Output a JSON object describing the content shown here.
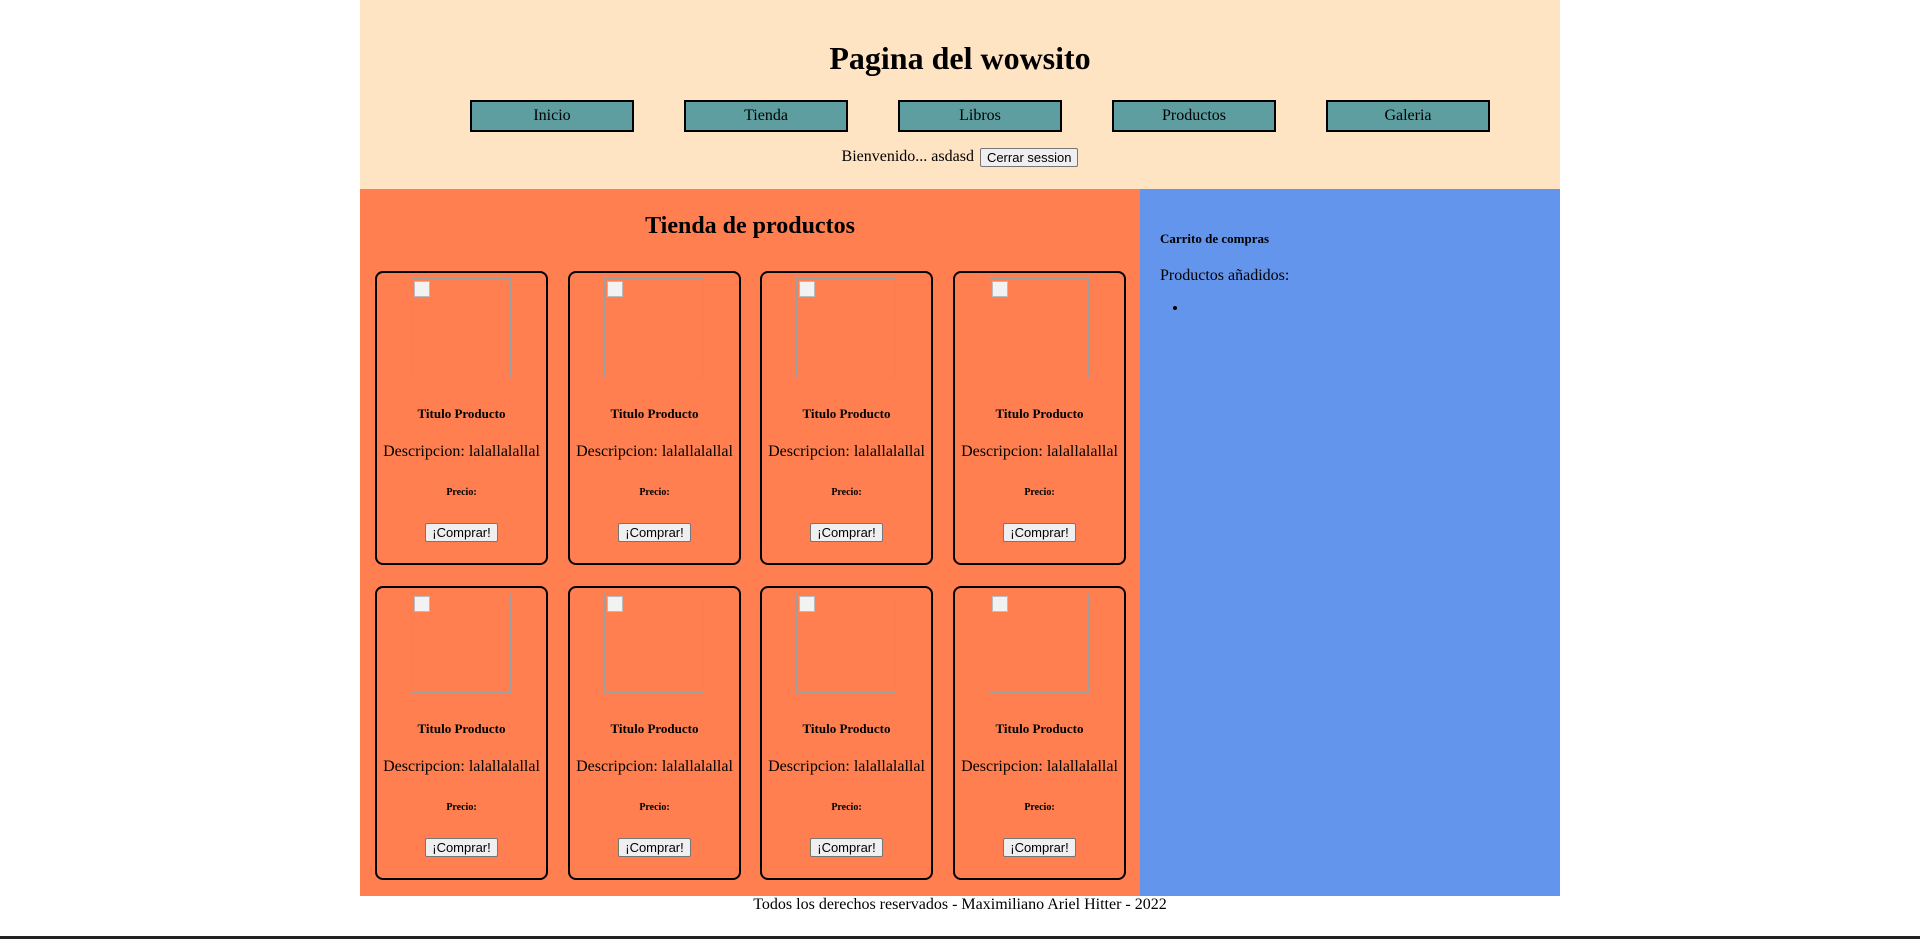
{
  "header": {
    "title": "Pagina del wowsito",
    "nav": [
      {
        "label": "Inicio"
      },
      {
        "label": "Tienda"
      },
      {
        "label": "Libros"
      },
      {
        "label": "Productos"
      },
      {
        "label": "Galeria"
      }
    ],
    "welcome_text": "Bienvenido... asdasd",
    "logout_label": "Cerrar session"
  },
  "store": {
    "heading": "Tienda de productos",
    "products": [
      {
        "title": "Titulo Producto",
        "description": "Descripcion: lalallalallal",
        "price_label": "Precio:",
        "buy_label": "¡Comprar!"
      },
      {
        "title": "Titulo Producto",
        "description": "Descripcion: lalallalallal",
        "price_label": "Precio:",
        "buy_label": "¡Comprar!"
      },
      {
        "title": "Titulo Producto",
        "description": "Descripcion: lalallalallal",
        "price_label": "Precio:",
        "buy_label": "¡Comprar!"
      },
      {
        "title": "Titulo Producto",
        "description": "Descripcion: lalallalallal",
        "price_label": "Precio:",
        "buy_label": "¡Comprar!"
      },
      {
        "title": "Titulo Producto",
        "description": "Descripcion: lalallalallal",
        "price_label": "Precio:",
        "buy_label": "¡Comprar!"
      },
      {
        "title": "Titulo Producto",
        "description": "Descripcion: lalallalallal",
        "price_label": "Precio:",
        "buy_label": "¡Comprar!"
      },
      {
        "title": "Titulo Producto",
        "description": "Descripcion: lalallalallal",
        "price_label": "Precio:",
        "buy_label": "¡Comprar!"
      },
      {
        "title": "Titulo Producto",
        "description": "Descripcion: lalallalallal",
        "price_label": "Precio:",
        "buy_label": "¡Comprar!"
      }
    ]
  },
  "cart": {
    "heading": "Carrito de compras",
    "added_label": "Productos añadidos:",
    "items": [
      ""
    ]
  },
  "footer": {
    "text": "Todos los derechos reservados - Maximiliano Ariel Hitter - 2022"
  },
  "colors": {
    "header_bg": "#ffe4c4",
    "nav_button_bg": "#5f9ea0",
    "store_bg": "#ff7f50",
    "cart_bg": "#6495ed"
  }
}
